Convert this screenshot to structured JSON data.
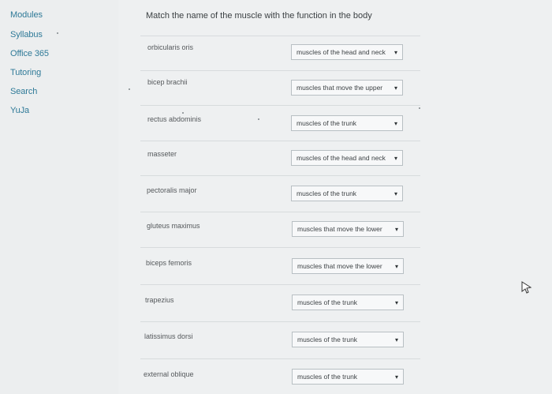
{
  "sidebar": {
    "items": [
      {
        "label": "Modules"
      },
      {
        "label": "Syllabus"
      },
      {
        "label": "Office 365"
      },
      {
        "label": "Tutoring"
      },
      {
        "label": "Search"
      },
      {
        "label": "YuJa"
      }
    ]
  },
  "question": {
    "text": "Match the name of the muscle with the function in the body"
  },
  "rows": [
    {
      "term": "orbicularis oris",
      "selected": "muscles of the head and neck"
    },
    {
      "term": "bicep brachii",
      "selected": "muscles that move the upper"
    },
    {
      "term": "rectus abdominis",
      "selected": "muscles of the trunk"
    },
    {
      "term": "masseter",
      "selected": "muscles of the head and neck"
    },
    {
      "term": "pectoralis major",
      "selected": "muscles of the trunk"
    },
    {
      "term": "gluteus maximus",
      "selected": "muscles that move the lower"
    },
    {
      "term": "biceps femoris",
      "selected": "muscles that move the lower"
    },
    {
      "term": "trapezius",
      "selected": "muscles of the trunk"
    },
    {
      "term": "latissimus dorsi",
      "selected": "muscles of the trunk"
    },
    {
      "term": "external oblique",
      "selected": "muscles of the trunk"
    }
  ]
}
